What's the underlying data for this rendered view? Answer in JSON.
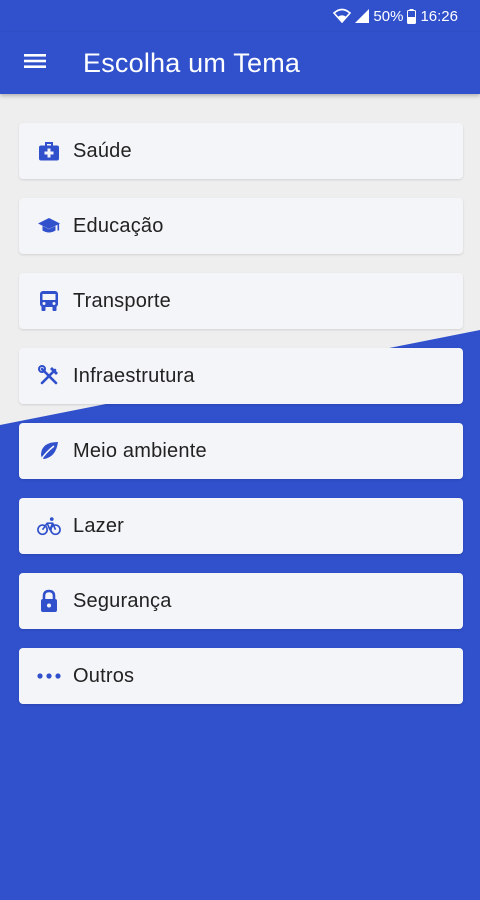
{
  "colors": {
    "primary": "#3050cc",
    "light_background": "#eeeeee",
    "card_background": "#f4f5f8",
    "icon": "#3050cc",
    "text": "#222222"
  },
  "status_bar": {
    "battery_percent": "50%",
    "time": "16:26",
    "icons": [
      "wifi-icon",
      "signal-icon",
      "battery-icon"
    ]
  },
  "app_bar": {
    "menu_icon": "menu-icon",
    "title": "Escolha um Tema"
  },
  "topics": [
    {
      "label": "Saúde",
      "icon": "medical-kit-icon"
    },
    {
      "label": "Educação",
      "icon": "graduation-cap-icon"
    },
    {
      "label": "Transporte",
      "icon": "bus-icon"
    },
    {
      "label": "Infraestrutura",
      "icon": "tools-icon"
    },
    {
      "label": "Meio ambiente",
      "icon": "leaf-icon"
    },
    {
      "label": "Lazer",
      "icon": "bicycle-icon"
    },
    {
      "label": "Segurança",
      "icon": "lock-icon"
    },
    {
      "label": "Outros",
      "icon": "more-dots-icon"
    }
  ]
}
